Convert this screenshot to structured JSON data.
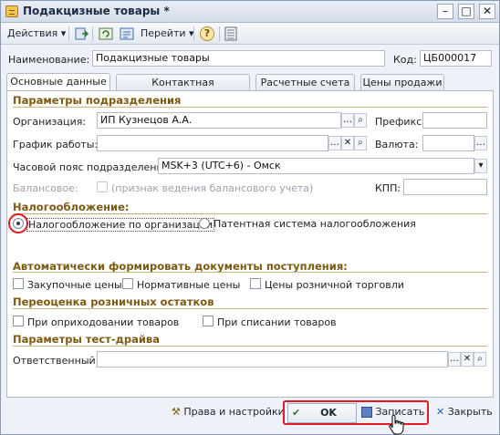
{
  "window": {
    "title": "Подакцизные товары *",
    "minimize": "–",
    "maximize": "□",
    "close": "✕"
  },
  "toolbar": {
    "actions_label": "Действия",
    "goto_label": "Перейти",
    "help_label": "?"
  },
  "header": {
    "name_label": "Наименование:",
    "name_value": "Подакцизные товары",
    "code_label": "Код:",
    "code_value": "ЦБ000017"
  },
  "tabs": [
    {
      "label": "Основные данные"
    },
    {
      "label": "Контактная информация"
    },
    {
      "label": "Расчетные счета"
    },
    {
      "label": "Цены продажи"
    }
  ],
  "division": {
    "section_title": "Параметры подразделения",
    "org_label": "Организация:",
    "org_value": "ИП Кузнецов А.А.",
    "prefix_label": "Префикс:",
    "prefix_value": "",
    "schedule_label": "График работы:",
    "schedule_value": "",
    "currency_label": "Валюта:",
    "currency_value": "",
    "tz_label": "Часовой пояс подразделения:",
    "tz_value": "MSK+3 (UTC+6) - Омск",
    "balance_label": "Балансовое:",
    "balance_checkbox": "(признак ведения балансового учета)",
    "kpp_label": "КПП:",
    "kpp_value": ""
  },
  "taxation": {
    "section_title": "Налогообложение:",
    "option_org": "Налогообложение по организации",
    "option_patent": "Патентная система налогообложения",
    "selected": "option_org"
  },
  "auto_docs": {
    "section_title": "Автоматически формировать документы поступления:",
    "purchase_prices": "Закупочные цены",
    "normative_prices": "Нормативные цены",
    "retail_prices": "Цены розничной торговли"
  },
  "revaluation": {
    "section_title": "Переоценка розничных остатков",
    "on_receipt": "При оприходовании товаров",
    "on_writeoff": "При списании товаров"
  },
  "testdrive": {
    "section_title": "Параметры тест-драйва",
    "responsible_label": "Ответственный:",
    "responsible_value": ""
  },
  "footer": {
    "rights_label": "Права и настройки",
    "ok_label": "OK",
    "save_label": "Записать",
    "close_label": "Закрыть"
  },
  "colors": {
    "highlight": "#e01b24",
    "section": "#7b5a12"
  }
}
